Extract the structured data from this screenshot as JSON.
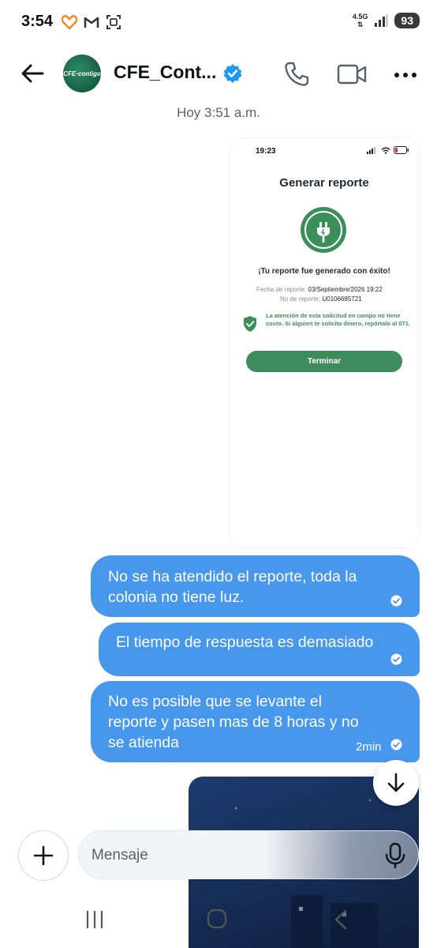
{
  "status_bar": {
    "time": "3:54",
    "network_type": "4.5G",
    "battery_level": "93"
  },
  "header": {
    "avatar_text": "CFE·contigo",
    "contact_name": "CFE_Cont...",
    "verified": true
  },
  "conversation": {
    "timestamp": "Hoy 3:51 a.m.",
    "attachment": {
      "status_time": "19:23",
      "title": "Generar reporte",
      "success_message": "¡Tu reporte fue generado con éxito!",
      "date_label": "Fecha de reporte:",
      "date_value": "03/Septiembre/2026 19:22",
      "number_label": "No de reporte:",
      "number_value": "U0106685721",
      "notice": "La atención de esta solicitud en campo no tiene costo. Si alguien te solicita dinero, repórtalo al 071.",
      "button_label": "Terminar"
    },
    "messages": [
      {
        "lines": [
          "No se ha atendido el reporte, toda  la",
          "colonia no tiene luz."
        ]
      },
      {
        "lines": [
          "El tiempo de respuesta es demasiado"
        ]
      },
      {
        "lines": [
          "No es posible que se levante el",
          "reporte y pasen mas de 8 horas y no",
          "se atienda"
        ],
        "time": "2min"
      }
    ]
  },
  "composer": {
    "placeholder": "Mensaje"
  },
  "colors": {
    "bubble": "#4797ed",
    "brand_green": "#3a8f5a",
    "verified_blue": "#1d9bf0"
  }
}
